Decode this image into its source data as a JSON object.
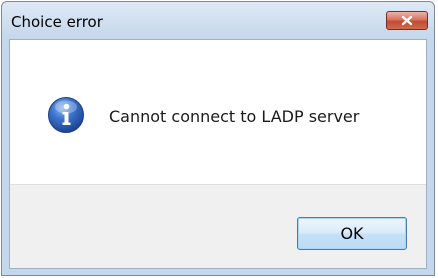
{
  "dialog": {
    "title": "Choice error",
    "message": "Cannot connect to LADP server",
    "ok_label": "OK"
  },
  "icons": {
    "info": "info-icon",
    "close": "close-icon"
  },
  "colors": {
    "close_button": "#c8513a",
    "info_icon_blue": "#2a5db8",
    "ok_button_border": "#3c7fb1",
    "button_area_bg": "#f0f0f0"
  }
}
